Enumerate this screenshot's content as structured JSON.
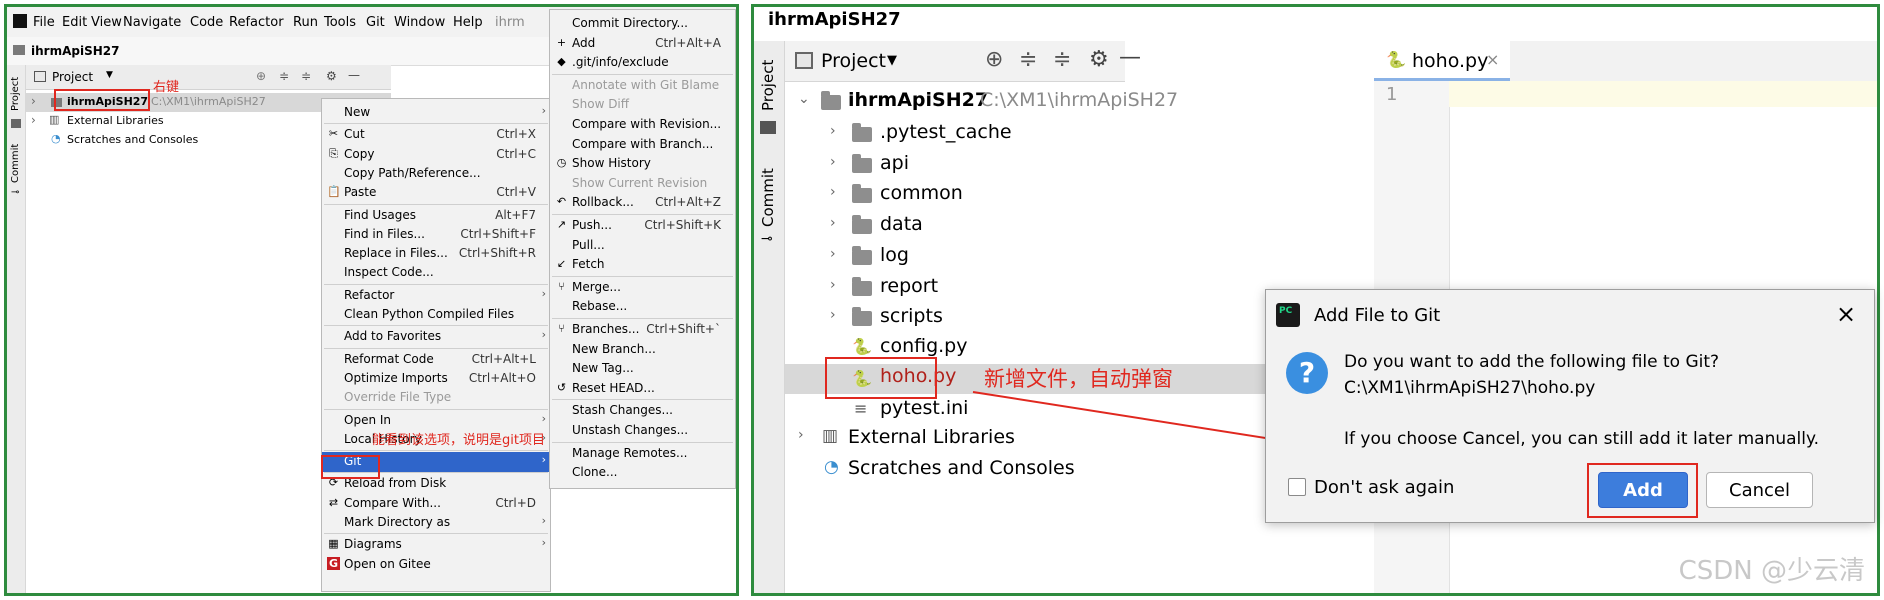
{
  "left": {
    "menu": [
      "File",
      "Edit",
      "View",
      "Navigate",
      "Code",
      "Refactor",
      "Run",
      "Tools",
      "Git",
      "Window",
      "Help"
    ],
    "menu_tail": "ihrm",
    "breadcrumb": "ihrmApiSH27",
    "strip": {
      "project": "Project",
      "commit": "Commit"
    },
    "project_tab": "Project",
    "tree": {
      "root_name": "ihrmApiSH27",
      "root_path": "C:\\XM1\\ihrmApiSH27",
      "ext": "External Libraries",
      "scratch": "Scratches and Consoles"
    },
    "annotation_right_click": "右键",
    "annotation_git": "能看到该选项，说明是git项目",
    "context_menu": [
      {
        "label": "New",
        "sc": "",
        "sub": true
      },
      {
        "label": "Cut",
        "sc": "Ctrl+X",
        "icon": "✂"
      },
      {
        "label": "Copy",
        "sc": "Ctrl+C",
        "icon": "⎘"
      },
      {
        "label": "Copy Path/Reference...",
        "sc": ""
      },
      {
        "label": "Paste",
        "sc": "Ctrl+V",
        "icon": "📋"
      },
      {
        "label": "Find Usages",
        "sc": "Alt+F7"
      },
      {
        "label": "Find in Files...",
        "sc": "Ctrl+Shift+F"
      },
      {
        "label": "Replace in Files...",
        "sc": "Ctrl+Shift+R"
      },
      {
        "label": "Inspect Code...",
        "sc": ""
      },
      {
        "label": "Refactor",
        "sc": "",
        "sub": true
      },
      {
        "label": "Clean Python Compiled Files",
        "sc": ""
      },
      {
        "label": "Add to Favorites",
        "sc": "",
        "sub": true
      },
      {
        "label": "Reformat Code",
        "sc": "Ctrl+Alt+L"
      },
      {
        "label": "Optimize Imports",
        "sc": "Ctrl+Alt+O"
      },
      {
        "label": "Override File Type",
        "sc": "",
        "disabled": true
      },
      {
        "label": "Open In",
        "sc": "",
        "sub": true
      },
      {
        "label": "Local History",
        "sc": "",
        "sub": true
      },
      {
        "label": "Git",
        "sc": "",
        "sub": true,
        "selected": true
      },
      {
        "label": "Reload from Disk",
        "sc": "",
        "icon": "⟳"
      },
      {
        "label": "Compare With...",
        "sc": "Ctrl+D",
        "icon": "⇄"
      },
      {
        "label": "Mark Directory as",
        "sc": "",
        "sub": true
      },
      {
        "label": "Diagrams",
        "sc": "",
        "sub": true,
        "icon": "▦"
      },
      {
        "label": "Open on Gitee",
        "sc": "",
        "icon": "G"
      }
    ],
    "git_menu": [
      {
        "label": "Commit Directory...",
        "sc": ""
      },
      {
        "label": "Add",
        "sc": "Ctrl+Alt+A",
        "icon": "+"
      },
      {
        "label": ".git/info/exclude",
        "sc": "",
        "icon": "◆"
      },
      {
        "label": "Annotate with Git Blame",
        "sc": "",
        "disabled": true
      },
      {
        "label": "Show Diff",
        "sc": "",
        "disabled": true
      },
      {
        "label": "Compare with Revision...",
        "sc": ""
      },
      {
        "label": "Compare with Branch...",
        "sc": ""
      },
      {
        "label": "Show History",
        "sc": "",
        "icon": "◷"
      },
      {
        "label": "Show Current Revision",
        "sc": "",
        "disabled": true
      },
      {
        "label": "Rollback...",
        "sc": "Ctrl+Alt+Z",
        "icon": "↶"
      },
      {
        "label": "Push...",
        "sc": "Ctrl+Shift+K",
        "icon": "↗"
      },
      {
        "label": "Pull...",
        "sc": ""
      },
      {
        "label": "Fetch",
        "sc": "",
        "icon": "↙"
      },
      {
        "label": "Merge...",
        "sc": "",
        "icon": "⑂"
      },
      {
        "label": "Rebase...",
        "sc": ""
      },
      {
        "label": "Branches...",
        "sc": "Ctrl+Shift+`",
        "icon": "⑂"
      },
      {
        "label": "New Branch...",
        "sc": ""
      },
      {
        "label": "New Tag...",
        "sc": ""
      },
      {
        "label": "Reset HEAD...",
        "sc": "",
        "icon": "↺"
      },
      {
        "label": "Stash Changes...",
        "sc": ""
      },
      {
        "label": "Unstash Changes...",
        "sc": ""
      },
      {
        "label": "Manage Remotes...",
        "sc": ""
      },
      {
        "label": "Clone...",
        "sc": ""
      }
    ]
  },
  "right": {
    "title": "ihrmApiSH27",
    "strip": {
      "project": "Project",
      "commit": "Commit"
    },
    "project_tab": "Project",
    "tree": {
      "root_name": "ihrmApiSH27",
      "root_path": "C:\\XM1\\ihrmApiSH27",
      "folders": [
        ".pytest_cache",
        "api",
        "common",
        "data",
        "log",
        "report",
        "scripts"
      ],
      "files": [
        "config.py",
        "hoho.py",
        "pytest.ini"
      ],
      "ext": "External Libraries",
      "scratch": "Scratches and Consoles"
    },
    "editor_tab": "hoho.py",
    "line_number": "1",
    "annotation": "新增文件，自动弹窗",
    "dialog": {
      "title": "Add File to Git",
      "question": "Do you want to add the following file to Git?",
      "path": "C:\\XM1\\ihrmApiSH27\\hoho.py",
      "note": "If you choose Cancel, you can still add it later manually.",
      "checkbox": "Don't ask again",
      "add": "Add",
      "cancel": "Cancel"
    },
    "watermark": "CSDN @少云清"
  },
  "colors": {
    "frame": "#2e8b3e",
    "annotation": "#e0281f",
    "selection": "#2f65ca",
    "primary": "#3d7ddc"
  }
}
